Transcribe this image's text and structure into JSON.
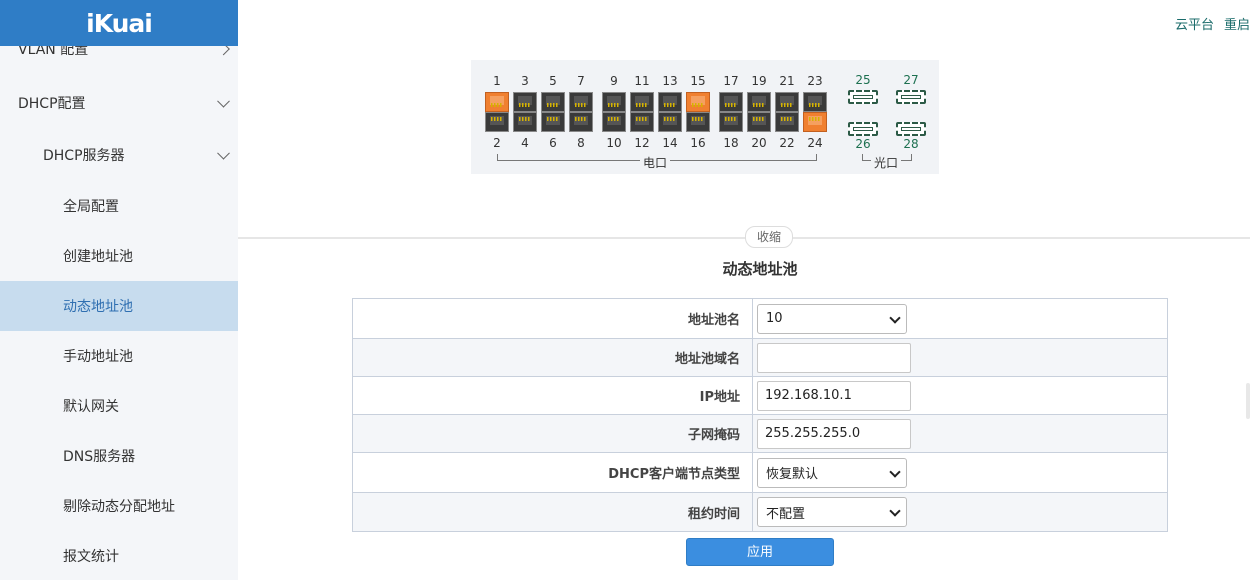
{
  "brand": {
    "logo": "iKuai",
    "accent": "#2f7dc6"
  },
  "top_links": {
    "cloud": "云平台",
    "restart": "重启"
  },
  "sidebar": {
    "vlan": "VLAN 配置",
    "dhcp_config": "DHCP配置",
    "dhcp_server": "DHCP服务器",
    "items": [
      {
        "label": "全局配置",
        "active": false
      },
      {
        "label": "创建地址池",
        "active": false
      },
      {
        "label": "动态地址池",
        "active": true
      },
      {
        "label": "手动地址池",
        "active": false
      },
      {
        "label": "默认网关",
        "active": false
      },
      {
        "label": "DNS服务器",
        "active": false
      },
      {
        "label": "剔除动态分配地址",
        "active": false
      },
      {
        "label": "报文统计",
        "active": false
      }
    ]
  },
  "switch_panel": {
    "top_ports": [
      "1",
      "3",
      "5",
      "7",
      "9",
      "11",
      "13",
      "15",
      "17",
      "19",
      "21",
      "23"
    ],
    "bottom_ports": [
      "2",
      "4",
      "6",
      "8",
      "10",
      "12",
      "14",
      "16",
      "18",
      "20",
      "22",
      "24"
    ],
    "sfp_top": [
      "25",
      "27"
    ],
    "sfp_bottom": [
      "26",
      "28"
    ],
    "active_ports": [
      "1",
      "15",
      "24"
    ],
    "electric_label": "电口",
    "optical_label": "光口"
  },
  "collapse_label": "收缩",
  "section_title": "动态地址池",
  "form": {
    "pool_name": {
      "label": "地址池名",
      "value": "10"
    },
    "domain": {
      "label": "地址池域名",
      "value": ""
    },
    "ip": {
      "label": "IP地址",
      "value": "192.168.10.1"
    },
    "mask": {
      "label": "子网掩码",
      "value": "255.255.255.0"
    },
    "node_type": {
      "label": "DHCP客户端节点类型",
      "value": "恢复默认"
    },
    "lease": {
      "label": "租约时间",
      "value": "不配置"
    }
  },
  "apply_label": "应用"
}
